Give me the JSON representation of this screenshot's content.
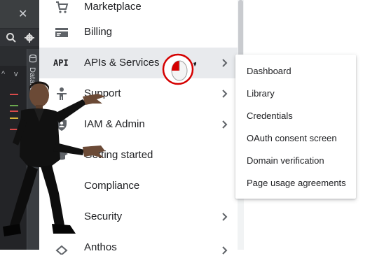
{
  "ide": {
    "close_glyph": "✕",
    "side_tab": "Databa"
  },
  "menu": {
    "items": [
      {
        "label": "Marketplace",
        "icon": "cart-icon",
        "chevron": false
      },
      {
        "label": "Billing",
        "icon": "billing-icon",
        "chevron": false
      },
      {
        "label": "APIs & Services",
        "icon": "api-icon",
        "icon_text": "API",
        "chevron": true,
        "active": true
      },
      {
        "label": "Support",
        "icon": "support-icon",
        "chevron": true
      },
      {
        "label": "IAM & Admin",
        "icon": "shield-icon",
        "chevron": true
      },
      {
        "label": "Getting started",
        "icon": "graduation-cap-icon",
        "chevron": false
      },
      {
        "label": "Compliance",
        "icon": "compliance-icon",
        "chevron": false
      },
      {
        "label": "Security",
        "icon": "security-icon",
        "chevron": true
      },
      {
        "label": "Anthos",
        "icon": "anthos-icon",
        "chevron": true
      }
    ]
  },
  "flyout": {
    "items": [
      "Dashboard",
      "Library",
      "Credentials",
      "OAuth consent screen",
      "Domain verification",
      "Page usage agreements"
    ]
  },
  "colors": {
    "active_row": "#e8eaed",
    "text": "#202124",
    "cursor_ring": "#d50000"
  }
}
